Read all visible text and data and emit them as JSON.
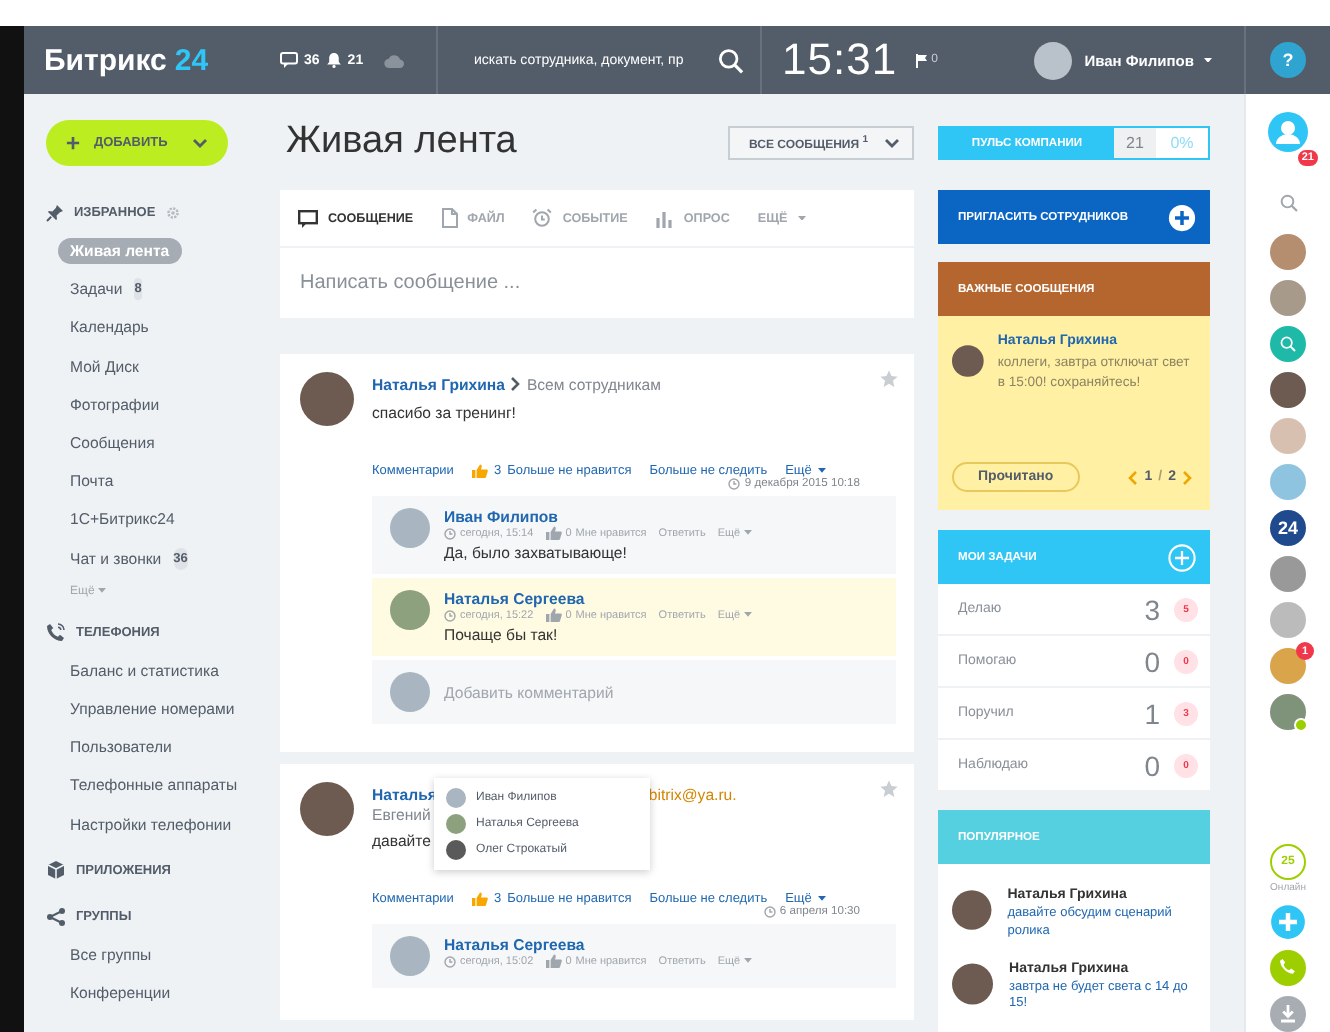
{
  "header": {
    "logo_text": "Битрикс",
    "logo_number": "24",
    "chat_count": "36",
    "notify_count": "21",
    "search": {
      "placeholder": "искать сотрудника, документ, пр"
    },
    "time": "15:31",
    "flag_count": "0",
    "user_name": "Иван Филипов",
    "help": "?"
  },
  "sidebar": {
    "add_button": "ДОБАВИТЬ",
    "sections": [
      {
        "title": "ИЗБРАННОЕ",
        "items": [
          {
            "label": "Живая лента",
            "selected": true
          },
          {
            "label": "Задачи",
            "badge": "8",
            "selected": false
          },
          {
            "label": "Календарь",
            "selected": false
          },
          {
            "label": "Мой Диск",
            "selected": false
          },
          {
            "label": "Фотографии",
            "selected": false
          },
          {
            "label": "Сообщения",
            "selected": false
          },
          {
            "label": "Почта",
            "selected": false
          },
          {
            "label": "1С+Битрикс24",
            "selected": false
          },
          {
            "label": "Чат и звонки",
            "badge": "36",
            "selected": false
          }
        ],
        "more": "Ещё"
      },
      {
        "title": "ТЕЛЕФОНИЯ",
        "items": [
          {
            "label": "Баланс и статистика",
            "selected": false
          },
          {
            "label": "Управление номерами",
            "selected": false
          },
          {
            "label": "Пользователи",
            "selected": false
          },
          {
            "label": "Телефонные аппараты",
            "selected": false
          },
          {
            "label": "Настройки телефонии",
            "selected": false
          }
        ]
      },
      {
        "title": "ПРИЛОЖЕНИЯ"
      },
      {
        "title": "ГРУППЫ",
        "items": [
          {
            "label": "Все группы",
            "selected": false
          },
          {
            "label": "Конференции",
            "selected": false
          }
        ]
      }
    ]
  },
  "feed": {
    "title": "Живая лента",
    "filter": "ВСЕ СООБЩЕНИЯ",
    "filter_count": "1",
    "composer": {
      "tabs": [
        {
          "label": "СООБЩЕНИЕ",
          "selected": true
        },
        {
          "label": "ФАЙЛ",
          "selected": false
        },
        {
          "label": "СОБЫТИЕ",
          "selected": false
        },
        {
          "label": "ОПРОС",
          "selected": false
        },
        {
          "label": "ЕЩЁ",
          "selected": false
        }
      ],
      "placeholder": "Написать сообщение ..."
    },
    "posts": [
      {
        "author": "Наталья Грихина",
        "recipient": "Всем сотрудникам",
        "lines": [
          "спасибо за тренинг!"
        ],
        "comments_link": "Комментарии",
        "likes": "3",
        "like_text": "Больше не нравится",
        "follow_text": "Больше не следить",
        "more": "Ещё",
        "date": "9 декабря 2015 10:18",
        "comments": [
          {
            "author": "Иван Филипов",
            "time": "сегодня, 15:14",
            "likes": "0",
            "like_text": "Мне нравится",
            "reply": "Ответить",
            "more": "Ещё",
            "text": "Да, было захватывающе!",
            "unread": false
          },
          {
            "author": "Наталья Сергеева",
            "time": "сегодня, 15:22",
            "likes": "0",
            "like_text": "Мне нравится",
            "reply": "Ответить",
            "more": "Ещё",
            "text": "Почаще бы так!",
            "unread": true
          }
        ],
        "add_comment": "Добавить комментарий"
      },
      {
        "author": "Наталья",
        "recipient": "bitrix@ya.ru.",
        "lines": [
          "Евгений",
          "давайте"
        ],
        "comments_link": "Комментарии",
        "likes": "3",
        "like_text": "Больше не нравится",
        "follow_text": "Больше не следить",
        "more": "Ещё",
        "date": "6 апреля 10:30",
        "likers": [
          "Иван Филипов",
          "Наталья Сергеева",
          "Олег Строкатый"
        ],
        "comments": [
          {
            "author": "Наталья Сергеева",
            "time": "сегодня, 15:02",
            "likes": "0",
            "like_text": "Мне нравится",
            "reply": "Ответить",
            "more": "Ещё",
            "unread": false
          }
        ]
      }
    ]
  },
  "right": {
    "pulse": {
      "label": "ПУЛЬС КОМПАНИИ",
      "value": "21",
      "percent": "0%"
    },
    "invite": "ПРИГЛАСИТЬ СОТРУДНИКОВ",
    "important": {
      "title": "ВАЖНЫЕ СООБЩЕНИЯ",
      "author": "Наталья Грихина",
      "text": "коллеги, завтра отключат свет в 15:00! сохраняйтесь!",
      "button": "Прочитано",
      "page": "1",
      "separator": "/",
      "total": "2"
    },
    "tasks": {
      "title": "МОИ ЗАДАЧИ",
      "rows": [
        {
          "label": "Делаю",
          "count": "3",
          "badge": "5"
        },
        {
          "label": "Помогаю",
          "count": "0",
          "badge": "0"
        },
        {
          "label": "Поручил",
          "count": "1",
          "badge": "3"
        },
        {
          "label": "Наблюдаю",
          "count": "0",
          "badge": "0"
        }
      ]
    },
    "popular": {
      "title": "ПОПУЛЯРНОЕ",
      "items": [
        {
          "author": "Наталья Грихина",
          "text": "давайте обсудим сценарий ролика"
        },
        {
          "author": "Наталья Грихина",
          "text": "завтра не будет света с 14 до 15!"
        }
      ]
    }
  },
  "rail": {
    "notifications": "21",
    "contacts": [
      {
        "kind": "photo",
        "online": false
      },
      {
        "kind": "photo",
        "online": false
      },
      {
        "kind": "app",
        "online": false
      },
      {
        "kind": "photo",
        "online": false
      },
      {
        "kind": "photo",
        "online": false
      },
      {
        "kind": "photo",
        "online": false
      },
      {
        "kind": "logo",
        "text": "24",
        "online": false
      },
      {
        "kind": "photo",
        "online": false
      },
      {
        "kind": "photo",
        "online": false
      },
      {
        "kind": "photo",
        "badge": "1",
        "online": false
      },
      {
        "kind": "photo",
        "online": true
      }
    ],
    "online_count": "25",
    "online_label": "Онлайн"
  }
}
